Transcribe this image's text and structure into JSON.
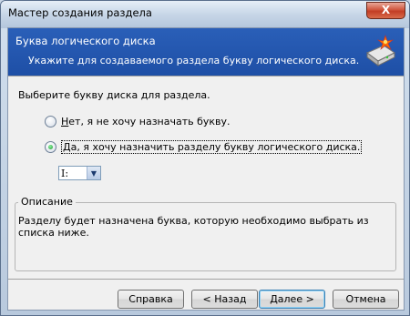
{
  "window": {
    "title": "Мастер создания раздела",
    "close_label": "X"
  },
  "header": {
    "title": "Буква логического диска",
    "subtitle": "Укажите для создаваемого раздела букву логического диска."
  },
  "prompt": "Выберите букву диска для раздела.",
  "options": [
    {
      "label": "Нет, я не хочу назначать букву.",
      "checked": false
    },
    {
      "label": "Да, я хочу назначить разделу букву логического диска.",
      "checked": true
    }
  ],
  "drive_select": {
    "value": "I:"
  },
  "description": {
    "legend": "Описание",
    "text": "Разделу будет назначена буква, которую необходимо выбрать из списка ниже."
  },
  "buttons": {
    "help": "Справка",
    "back": "< Назад",
    "next": "Далее >",
    "cancel": "Отмена"
  }
}
